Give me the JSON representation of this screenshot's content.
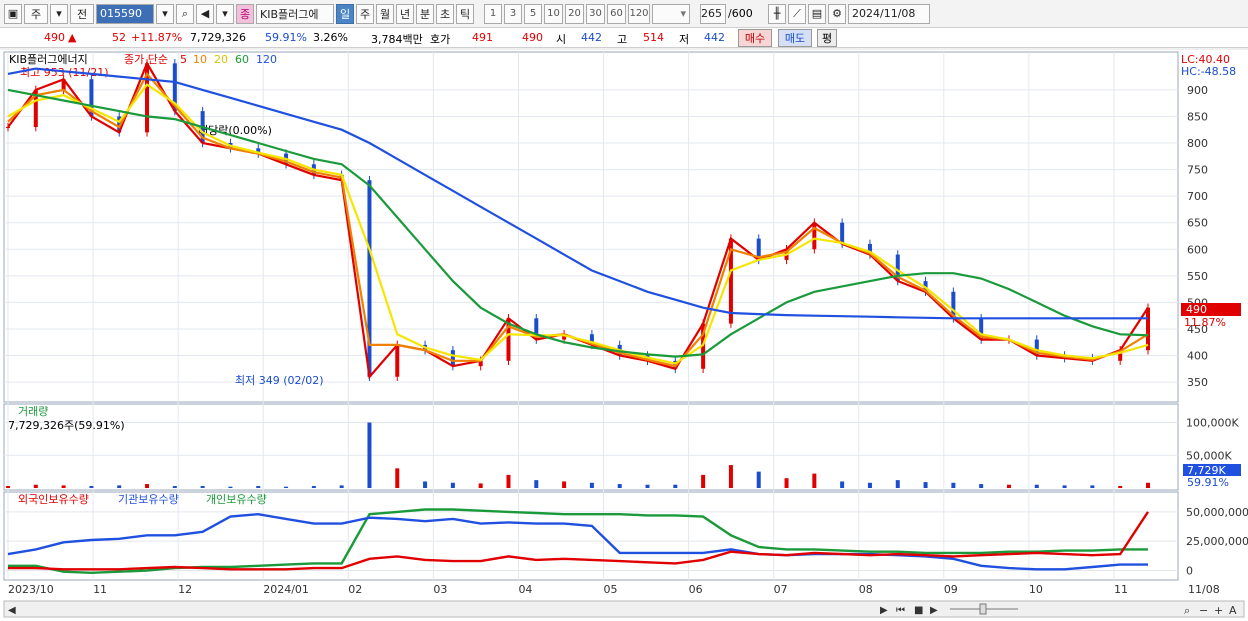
{
  "toolbar": {
    "market_type": "주",
    "view_mode": "전",
    "stock_code": "015590",
    "stock_name": "KIB플러그에",
    "badge": "종",
    "periods": [
      "일",
      "주",
      "월",
      "년",
      "분",
      "초",
      "틱"
    ],
    "active_period": "일",
    "intervals": [
      "1",
      "3",
      "5",
      "10",
      "20",
      "30",
      "60",
      "120"
    ],
    "count": "265",
    "count_max": "/600",
    "date": "2024/11/08"
  },
  "quote": {
    "price": "490",
    "arrow": "▲",
    "change": "52",
    "change_pct": "+11.87%",
    "volume": "7,729,326",
    "volume_ratio": "59.91%",
    "turnover": "3.26%",
    "amount": "3,784백만",
    "ask_label": "호가",
    "ask": "491",
    "bid": "490",
    "open_label": "시",
    "open": "442",
    "high_label": "고",
    "high": "514",
    "low_label": "저",
    "low": "442",
    "buy_label": "매수",
    "sell_label": "매도",
    "eval_label": "평"
  },
  "price_panel": {
    "stock_label": "KIB플러그에너지",
    "ma_label": "종가 단순",
    "ma_periods": [
      "5",
      "10",
      "20",
      "60",
      "120"
    ],
    "ma_colors": [
      "#e00000",
      "#f08000",
      "#f5e600",
      "#1a9a3a",
      "#2050e0"
    ],
    "high_annotation": "최고 953 (11/21)",
    "low_annotation": "최저 349 (02/02)",
    "dividend_annotation": "배당락(0.00%)",
    "lc_label": "LC:40.40",
    "hc_label": "HC:-48.58",
    "current_price_tag": "490",
    "current_pct_tag": "11.87%",
    "y_ticks": [
      "900",
      "850",
      "800",
      "750",
      "700",
      "650",
      "600",
      "550",
      "500",
      "450",
      "400",
      "350"
    ]
  },
  "volume_panel": {
    "title": "거래량",
    "value_label": "7,729,326주(59.91%)",
    "y_ticks": [
      "100,000K",
      "50,000K"
    ],
    "current_tag": "7,729K",
    "current_pct": "59.91%"
  },
  "holding_panel": {
    "series": [
      {
        "name": "외국인보유수량",
        "color": "#e00000"
      },
      {
        "name": "기관보유수량",
        "color": "#2050e0"
      },
      {
        "name": "개인보유수량",
        "color": "#1a9a3a"
      }
    ],
    "y_ticks": [
      "50,000,000",
      "25,000,000",
      "0"
    ]
  },
  "x_axis": {
    "labels": [
      "2023/10",
      "11",
      "12",
      "2024/01",
      "02",
      "03",
      "04",
      "05",
      "06",
      "07",
      "08",
      "09",
      "10",
      "11"
    ],
    "right_label": "11/08"
  },
  "chart_data": {
    "type": "line",
    "title": "KIB플러그에너지",
    "price_range": [
      320,
      960
    ],
    "months": [
      "2023/10",
      "11",
      "12",
      "2024/01",
      "02",
      "03",
      "04",
      "05",
      "06",
      "07",
      "08",
      "09",
      "10",
      "11"
    ],
    "series": [
      {
        "name": "5",
        "values": [
          830,
          900,
          920,
          850,
          820,
          950,
          860,
          800,
          790,
          780,
          760,
          740,
          730,
          360,
          420,
          410,
          380,
          390,
          470,
          430,
          440,
          420,
          400,
          390,
          375,
          460,
          620,
          580,
          600,
          650,
          610,
          590,
          540,
          520,
          470,
          430,
          430,
          400,
          395,
          390,
          410,
          490
        ]
      },
      {
        "name": "10",
        "values": [
          840,
          890,
          900,
          860,
          830,
          930,
          870,
          810,
          790,
          780,
          765,
          745,
          735,
          420,
          420,
          410,
          390,
          390,
          455,
          435,
          440,
          422,
          405,
          392,
          380,
          440,
          600,
          585,
          595,
          640,
          612,
          592,
          548,
          522,
          475,
          435,
          430,
          405,
          398,
          392,
          408,
          440
        ]
      },
      {
        "name": "20",
        "values": [
          850,
          880,
          890,
          865,
          840,
          910,
          875,
          820,
          795,
          782,
          770,
          750,
          740,
          600,
          440,
          415,
          400,
          392,
          440,
          438,
          438,
          425,
          410,
          396,
          385,
          420,
          560,
          580,
          590,
          620,
          612,
          595,
          560,
          528,
          485,
          440,
          430,
          410,
          400,
          395,
          405,
          420
        ]
      },
      {
        "name": "60",
        "values": [
          900,
          890,
          880,
          870,
          860,
          850,
          845,
          830,
          815,
          800,
          785,
          770,
          760,
          720,
          660,
          600,
          540,
          490,
          460,
          440,
          425,
          415,
          408,
          402,
          398,
          402,
          440,
          470,
          500,
          520,
          530,
          540,
          550,
          555,
          555,
          545,
          525,
          500,
          475,
          455,
          440,
          438
        ]
      },
      {
        "name": "120",
        "values": [
          930,
          940,
          935,
          930,
          925,
          920,
          915,
          900,
          885,
          870,
          855,
          840,
          825,
          800,
          770,
          740,
          710,
          680,
          650,
          620,
          590,
          560,
          540,
          520,
          505,
          490,
          480,
          478,
          476,
          475,
          474,
          473,
          472,
          471,
          470,
          470,
          470,
          470,
          470,
          470,
          470,
          470
        ]
      }
    ],
    "volume": [
      3,
      5,
      4,
      3,
      4,
      6,
      3,
      3,
      2,
      3,
      2,
      3,
      4,
      100,
      30,
      10,
      8,
      7,
      20,
      12,
      10,
      8,
      6,
      5,
      5,
      20,
      35,
      25,
      15,
      22,
      10,
      8,
      12,
      9,
      8,
      6,
      5,
      5,
      4,
      4,
      3,
      8
    ],
    "holdings": {
      "foreign": [
        2,
        2,
        1,
        1,
        1,
        2,
        3,
        2,
        1,
        1,
        1,
        2,
        2,
        10,
        12,
        9,
        8,
        8,
        12,
        9,
        10,
        9,
        8,
        7,
        6,
        9,
        16,
        14,
        13,
        15,
        14,
        13,
        14,
        13,
        12,
        13,
        14,
        15,
        14,
        13,
        14,
        50
      ],
      "institution": [
        14,
        18,
        24,
        26,
        27,
        30,
        30,
        33,
        46,
        48,
        44,
        40,
        40,
        45,
        44,
        42,
        44,
        40,
        41,
        40,
        40,
        38,
        15,
        15,
        15,
        15,
        18,
        14,
        13,
        14,
        14,
        14,
        13,
        12,
        10,
        4,
        2,
        1,
        1,
        3,
        5,
        5
      ],
      "individual": [
        4,
        4,
        -1,
        -2,
        -1,
        0,
        2,
        3,
        3,
        4,
        5,
        6,
        6,
        48,
        50,
        52,
        52,
        51,
        50,
        49,
        48,
        48,
        48,
        47,
        47,
        46,
        30,
        20,
        18,
        18,
        17,
        16,
        16,
        15,
        15,
        15,
        16,
        16,
        17,
        17,
        18,
        18
      ]
    }
  }
}
